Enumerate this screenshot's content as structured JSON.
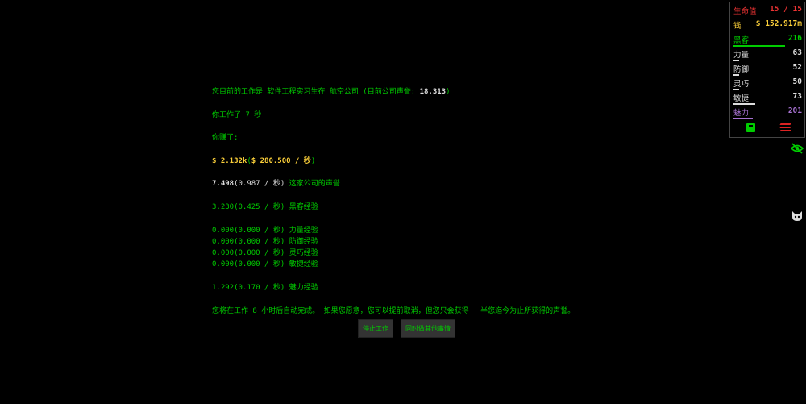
{
  "work": {
    "line1_prefix": "您目前的工作是 ",
    "job": "软件工程实习生",
    "line1_mid": "在 ",
    "company": "航空公司",
    "line1_rep_prefix": " (目前公司声誉: ",
    "company_rep": "18.313",
    "line1_suffix": ")",
    "worked_prefix": "你工作了 ",
    "worked_time": "7 秒",
    "earned_label": "你赚了:",
    "money": "$ 2.132k",
    "money_rate_open": "(",
    "money_rate": "$ 280.500 / 秒",
    "money_rate_close": ")",
    "rep_value": "7.498",
    "rep_rate": "(0.987 / 秒)",
    "rep_label": " 这家公司的声誉",
    "exp_lines": [
      "3.230(0.425 / 秒) 黑客经验",
      "0.000(0.000 / 秒) 力量经验",
      "0.000(0.000 / 秒) 防御经验",
      "0.000(0.000 / 秒) 灵巧经验",
      "0.000(0.000 / 秒) 敏捷经验",
      "1.292(0.170 / 秒) 魅力经验"
    ],
    "auto_complete_text": "您将在工作 8 小时后自动完成。 如果您愿意，您可以提前取消，但您只会获得 一半您迄今为止所获得的声誉。",
    "stop_button": "停止工作",
    "other_button": "同时做其他事情"
  },
  "stats": {
    "hp_label": "生命值",
    "hp_value": "15 / 15",
    "money_label": "钱",
    "money_value": "$ 152.917m",
    "hack_label": "黑客",
    "hack_value": "216",
    "hack_progress": 0.75,
    "str_label": "力量",
    "str_value": "63",
    "str_progress": 0.08,
    "def_label": "防御",
    "def_value": "52",
    "def_progress": 0.08,
    "dex_label": "灵巧",
    "dex_value": "50",
    "dex_progress": 0.08,
    "agi_label": "敏捷",
    "agi_value": "73",
    "agi_progress": 0.32,
    "cha_label": "魅力",
    "cha_value": "201",
    "cha_progress": 0.28
  },
  "colors": {
    "hp": "#e33",
    "money": "#fcd03a",
    "hack": "#00cc00",
    "combat": "#dddddd",
    "charisma": "#a671d1"
  },
  "icons": [
    "save-icon",
    "delete-icon",
    "eye-off-icon",
    "cat-icon"
  ]
}
